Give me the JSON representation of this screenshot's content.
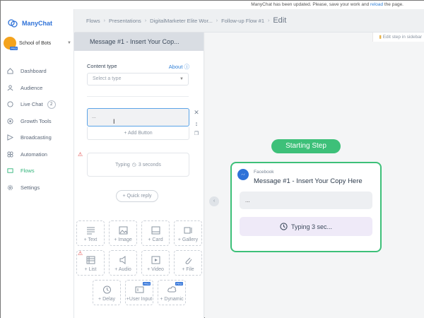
{
  "notice": {
    "text": "ManyChat has been updated. Please, save your work and ",
    "link": "reload",
    "tail": " the page."
  },
  "brand": {
    "name": "ManyChat"
  },
  "account": {
    "name": "School of Bots",
    "badge": "PRO"
  },
  "nav": [
    {
      "label": "Dashboard",
      "icon": "home-icon"
    },
    {
      "label": "Audience",
      "icon": "audience-icon"
    },
    {
      "label": "Live Chat",
      "icon": "chat-icon",
      "badge": "2"
    },
    {
      "label": "Growth Tools",
      "icon": "growth-icon"
    },
    {
      "label": "Broadcasting",
      "icon": "broadcast-icon"
    },
    {
      "label": "Automation",
      "icon": "automation-icon"
    },
    {
      "label": "Flows",
      "icon": "flows-icon",
      "active": true
    },
    {
      "label": "Settings",
      "icon": "settings-icon"
    }
  ],
  "breadcrumb": {
    "items": [
      "Flows",
      "Presentations",
      "DigitalMarketer Elite Wor...",
      "Follow-up Flow #1"
    ],
    "current": "Edit"
  },
  "panel": {
    "title": "Message #1 - Insert Your Cop...",
    "content_type_label": "Content type",
    "about": "About",
    "select_placeholder": "Select a type",
    "text_value": "...",
    "add_button": "+ Add Button",
    "typing_label": "Typing",
    "typing_value": "3 seconds",
    "quick_reply": "+ Quick reply"
  },
  "tiles": [
    {
      "label": "+ Text",
      "icon": "text-icon"
    },
    {
      "label": "+ Image",
      "icon": "image-icon"
    },
    {
      "label": "+ Card",
      "icon": "card-icon"
    },
    {
      "label": "+ Gallery",
      "icon": "gallery-icon"
    },
    {
      "label": "+ List",
      "icon": "list-icon"
    },
    {
      "label": "+ Audio",
      "icon": "audio-icon"
    },
    {
      "label": "+ Video",
      "icon": "video-icon"
    },
    {
      "label": "+ File",
      "icon": "file-icon"
    },
    {
      "label": "+ Delay",
      "icon": "clock-icon"
    },
    {
      "label": "+User Input",
      "icon": "user-input-icon",
      "pro": "PRO"
    },
    {
      "label": "+ Dynamic",
      "icon": "dynamic-icon",
      "pro": "PRO"
    }
  ],
  "canvas": {
    "edit_sidebar": "Edit step in sidebar",
    "starting_step": "Starting Step",
    "card": {
      "source": "Facebook",
      "title": "Message #1 - Insert Your Copy Here",
      "bubble": "...",
      "typing": "Typing 3 sec..."
    }
  },
  "colors": {
    "accent": "#3dc079",
    "brand": "#2f72d8",
    "link": "#2f7fd7",
    "warning": "#e24b4b"
  }
}
